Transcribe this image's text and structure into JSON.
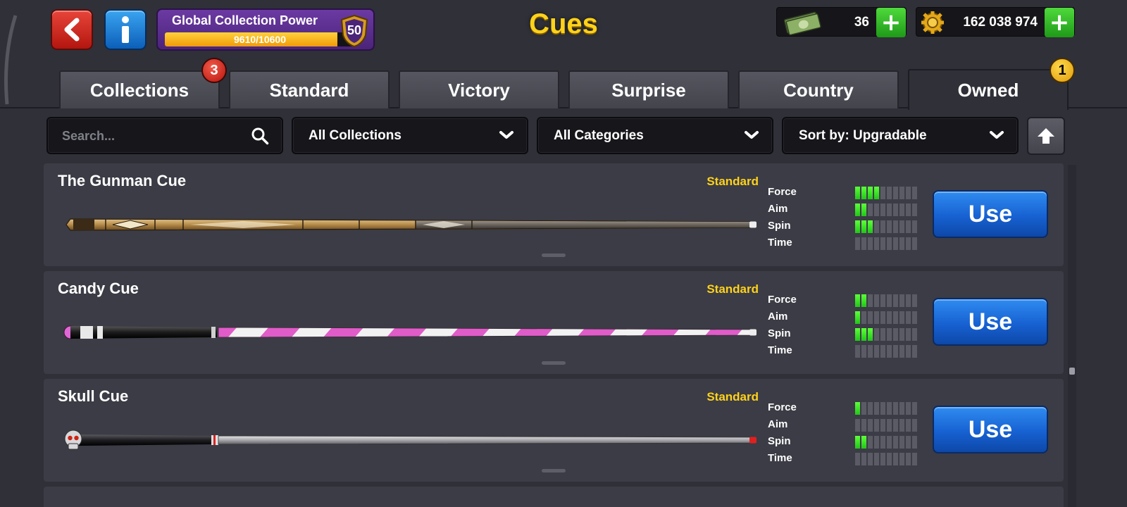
{
  "header": {
    "title": "Cues",
    "back_icon": "back-arrow-icon",
    "info_icon": "info-icon",
    "collection_power": {
      "label": "Global Collection Power",
      "progress_text": "9610/10600",
      "progress_value": 9610,
      "progress_max": 10600,
      "level": "50"
    },
    "currencies": [
      {
        "icon": "cash-icon",
        "value": "36"
      },
      {
        "icon": "coin-icon",
        "value": "162 038 974"
      }
    ],
    "add_label": "+"
  },
  "tabs": [
    {
      "label": "Collections",
      "badge": "3"
    },
    {
      "label": "Standard"
    },
    {
      "label": "Victory"
    },
    {
      "label": "Surprise"
    },
    {
      "label": "Country"
    },
    {
      "label": "Owned",
      "badge": "1",
      "active": true
    }
  ],
  "filters": {
    "search_placeholder": "Search...",
    "collections": "All Collections",
    "categories": "All Categories",
    "sort": "Sort by: Upgradable"
  },
  "cues": [
    {
      "name": "The Gunman Cue",
      "category": "Standard",
      "stats": {
        "Force": 4,
        "Aim": 2,
        "Spin": 3,
        "Time": 0
      },
      "button": "Use"
    },
    {
      "name": "Candy Cue",
      "category": "Standard",
      "stats": {
        "Force": 2,
        "Aim": 1,
        "Spin": 3,
        "Time": 0
      },
      "button": "Use"
    },
    {
      "name": "Skull Cue",
      "category": "Standard",
      "stats": {
        "Force": 1,
        "Aim": 0,
        "Spin": 2,
        "Time": 0
      },
      "button": "Use"
    }
  ],
  "stat_labels": [
    "Force",
    "Aim",
    "Spin",
    "Time"
  ],
  "stat_max": 10,
  "colors": {
    "title_gold": "#ffd21a",
    "category_gold": "#ffd21a",
    "stat_on": "#3de025",
    "use_button": "#1761d2",
    "plus_button": "#2fb526"
  }
}
